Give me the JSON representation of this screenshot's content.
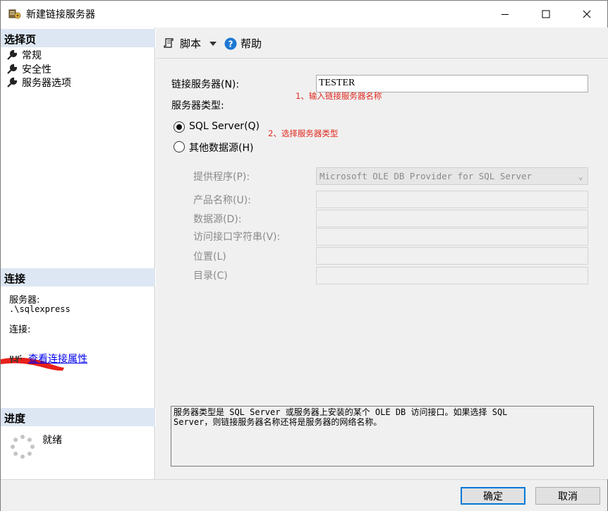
{
  "window": {
    "title": "新建链接服务器",
    "controls": [
      "minimize-icon",
      "maximize-icon",
      "close-icon"
    ]
  },
  "left_panel": {
    "select_page": {
      "header": "选择页",
      "items": [
        {
          "label": "常规",
          "icon": "wrench-icon"
        },
        {
          "label": "安全性",
          "icon": "wrench-icon"
        },
        {
          "label": "服务器选项",
          "icon": "wrench-icon"
        }
      ]
    },
    "connection": {
      "header": "连接",
      "server_label": "服务器:",
      "server_value": ".\\sqlexpress",
      "connection_label": "连接:",
      "view_props_link": "查看连接属性"
    },
    "progress": {
      "header": "进度",
      "status": "就绪"
    }
  },
  "toolbar": {
    "script_label": "脚本",
    "help_label": "帮助"
  },
  "form": {
    "linked_server_label": "链接服务器(N):",
    "linked_server_value": "TESTER",
    "annotation_1": "1、输入链接服务器名称",
    "server_type_label": "服务器类型:",
    "radio_sql_server": "SQL Server(Q)",
    "radio_other": "其他数据源(H)",
    "annotation_2": "2、选择服务器类型",
    "selected_server_type": "SQL Server",
    "provider_label": "提供程序(P):",
    "provider_value": "Microsoft OLE DB Provider for SQL Server",
    "product_name_label": "产品名称(U):",
    "data_source_label": "数据源(D):",
    "provider_string_label": "访问接口字符串(V):",
    "location_label": "位置(L)",
    "catalog_label": "目录(C)",
    "description": "服务器类型是 SQL Server 或服务器上安装的某个 OLE DB 访问接口。如果选择 SQL\nServer，则链接服务器名称还将是服务器的网络名称。"
  },
  "buttons": {
    "ok": "确定",
    "cancel": "取消"
  },
  "colors": {
    "section_header_bg": "#dde7f3",
    "annotation": "#e0281e",
    "link": "#0000ee",
    "accent": "#0078d7",
    "help_icon": "#1e78d2",
    "redaction": "#e8201a"
  }
}
